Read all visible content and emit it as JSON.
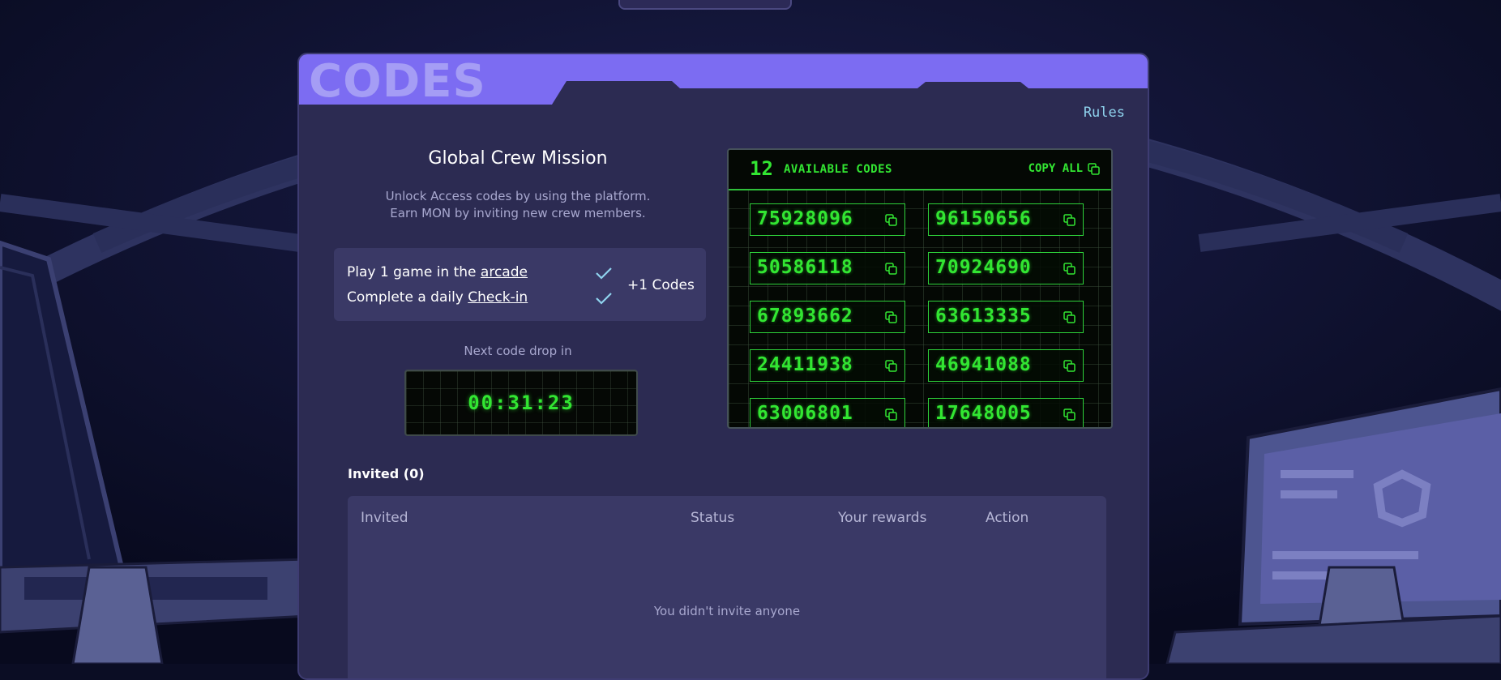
{
  "header": {
    "title": "CODES",
    "rules_label": "Rules"
  },
  "mission": {
    "title": "Global Crew Mission",
    "desc_line1": "Unlock Access codes by using the platform.",
    "desc_line2": "Earn MON by inviting new crew members."
  },
  "tasks": [
    {
      "prefix": "Play 1 game in the ",
      "link": "arcade",
      "completed": true
    },
    {
      "prefix": "Complete a daily ",
      "link": "Check-in",
      "completed": true
    }
  ],
  "reward": "+1 Codes",
  "next_drop": {
    "label": "Next code drop in",
    "timer": "00:31:23"
  },
  "codes_panel": {
    "count": "12",
    "available_label": "AVAILABLE CODES",
    "copy_all_label": "COPY ALL",
    "codes": [
      "75928096",
      "96150656",
      "50586118",
      "70924690",
      "67893662",
      "63613335",
      "24411938",
      "46941088",
      "63006801",
      "17648005"
    ]
  },
  "invited": {
    "label": "Invited (0)",
    "columns": [
      "Invited",
      "Status",
      "Your rewards",
      "Action"
    ],
    "empty_text": "You didn't invite anyone"
  },
  "colors": {
    "accent": "#7c6cf2",
    "terminal_green": "#32e632",
    "panel": "#2c2b52"
  }
}
